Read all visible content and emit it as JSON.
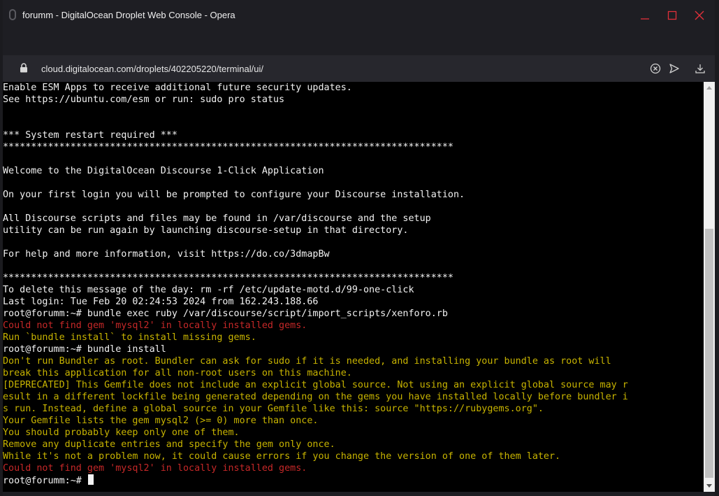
{
  "window": {
    "title": "forumm - DigitalOcean Droplet Web Console - Opera"
  },
  "address_bar": {
    "url": "cloud.digitalocean.com/droplets/402205220/terminal/ui/"
  },
  "terminal": {
    "lines": [
      {
        "text": "Enable ESM Apps to receive additional future security updates.",
        "style": "normal"
      },
      {
        "text": "See https://ubuntu.com/esm or run: sudo pro status",
        "style": "normal"
      },
      {
        "text": "",
        "style": "normal"
      },
      {
        "text": "",
        "style": "normal"
      },
      {
        "text": "*** System restart required ***",
        "style": "normal"
      },
      {
        "text": "********************************************************************************",
        "style": "normal"
      },
      {
        "text": "",
        "style": "normal"
      },
      {
        "text": "Welcome to the DigitalOcean Discourse 1-Click Application",
        "style": "normal"
      },
      {
        "text": "",
        "style": "normal"
      },
      {
        "text": "On your first login you will be prompted to configure your Discourse installation.",
        "style": "normal"
      },
      {
        "text": "",
        "style": "normal"
      },
      {
        "text": "All Discourse scripts and files may be found in /var/discourse and the setup",
        "style": "normal"
      },
      {
        "text": "utility can be run again by launching discourse-setup in that directory.",
        "style": "normal"
      },
      {
        "text": "",
        "style": "normal"
      },
      {
        "text": "For help and more information, visit https://do.co/3dmapBw",
        "style": "normal"
      },
      {
        "text": "",
        "style": "normal"
      },
      {
        "text": "********************************************************************************",
        "style": "normal"
      },
      {
        "text": "To delete this message of the day: rm -rf /etc/update-motd.d/99-one-click",
        "style": "normal"
      },
      {
        "text": "Last login: Tue Feb 20 02:24:53 2024 from 162.243.188.66",
        "style": "normal"
      },
      {
        "text": "root@forumm:~# bundle exec ruby /var/discourse/script/import_scripts/xenforo.rb",
        "style": "normal"
      },
      {
        "text": "Could not find gem 'mysql2' in locally installed gems.",
        "style": "err"
      },
      {
        "text": "Run `bundle install` to install missing gems.",
        "style": "warn"
      },
      {
        "text": "root@forumm:~# bundle install",
        "style": "normal"
      },
      {
        "text": "Don't run Bundler as root. Bundler can ask for sudo if it is needed, and installing your bundle as root will",
        "style": "warn"
      },
      {
        "text": "break this application for all non-root users on this machine.",
        "style": "warn"
      },
      {
        "text": "[DEPRECATED] This Gemfile does not include an explicit global source. Not using an explicit global source may r",
        "style": "warn"
      },
      {
        "text": "esult in a different lockfile being generated depending on the gems you have installed locally before bundler i",
        "style": "warn"
      },
      {
        "text": "s run. Instead, define a global source in your Gemfile like this: source \"https://rubygems.org\".",
        "style": "warn"
      },
      {
        "text": "Your Gemfile lists the gem mysql2 (>= 0) more than once.",
        "style": "warn"
      },
      {
        "text": "You should probably keep only one of them.",
        "style": "warn"
      },
      {
        "text": "Remove any duplicate entries and specify the gem only once.",
        "style": "warn"
      },
      {
        "text": "While it's not a problem now, it could cause errors if you change the version of one of them later.",
        "style": "warn"
      },
      {
        "text": "Could not find gem 'mysql2' in locally installed gems.",
        "style": "err"
      },
      {
        "text": "root@forumm:~# ",
        "style": "prompt"
      }
    ]
  },
  "icons": {
    "app": "opera-app-icon",
    "minimize": "minimize-icon",
    "maximize": "maximize-icon",
    "close": "close-icon",
    "lock": "lock-icon",
    "tracker": "tracker-blocker-icon",
    "send": "send-icon",
    "download": "download-icon"
  },
  "colors": {
    "terminal_bg": "#000000",
    "terminal_fg": "#f2f2f2",
    "error": "#c62828",
    "warning": "#c8b400",
    "close_accent": "#e0303a"
  }
}
